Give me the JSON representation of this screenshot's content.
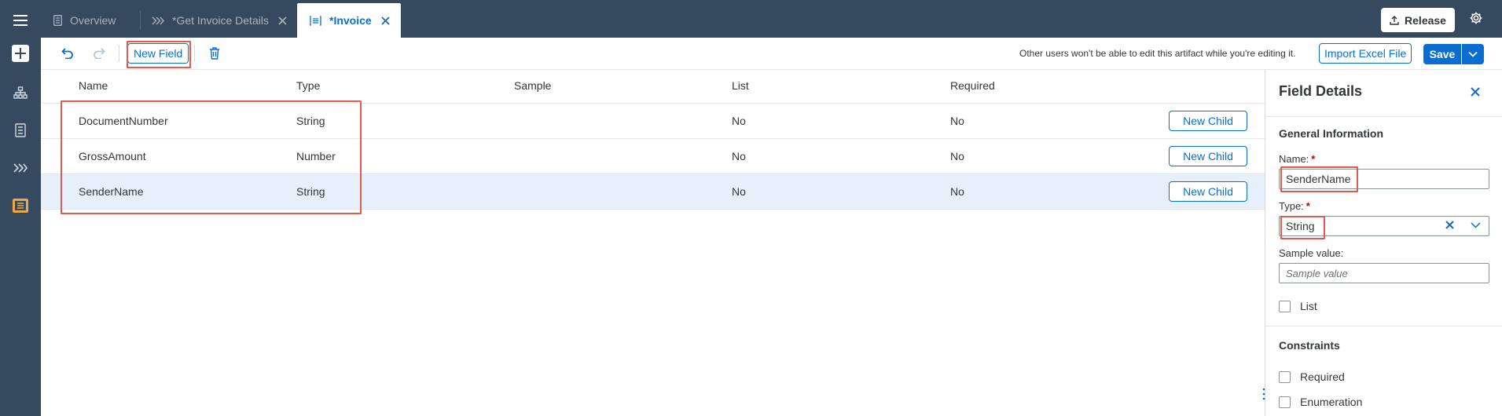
{
  "tabs": [
    {
      "label": "Overview",
      "icon": "document-icon",
      "active": false,
      "closable": false
    },
    {
      "label": "*Get Invoice Details",
      "icon": "chevrons-right-icon",
      "active": false,
      "closable": true
    },
    {
      "label": "*Invoice",
      "icon": "list-icon",
      "active": true,
      "closable": true
    }
  ],
  "header": {
    "release_label": "Release"
  },
  "toolbar": {
    "new_field_label": "New Field",
    "notice": "Other users won't be able to edit this artifact while you're editing it.",
    "import_label": "Import Excel File",
    "save_label": "Save"
  },
  "table": {
    "columns": [
      "Name",
      "Type",
      "Sample",
      "List",
      "Required"
    ],
    "rows": [
      {
        "name": "DocumentNumber",
        "type": "String",
        "sample": "",
        "list": "No",
        "required": "No",
        "action": "New Child"
      },
      {
        "name": "GrossAmount",
        "type": "Number",
        "sample": "",
        "list": "No",
        "required": "No",
        "action": "New Child"
      },
      {
        "name": "SenderName",
        "type": "String",
        "sample": "",
        "list": "No",
        "required": "No",
        "action": "New Child"
      }
    ],
    "selected_row": 2
  },
  "details": {
    "title": "Field Details",
    "general_title": "General Information",
    "name_label": "Name:",
    "name_value": "SenderName",
    "type_label": "Type:",
    "type_value": "String",
    "sample_label": "Sample value:",
    "sample_placeholder": "Sample value",
    "list_label": "List",
    "constraints_title": "Constraints",
    "required_label": "Required",
    "enumeration_label": "Enumeration"
  },
  "colors": {
    "shell": "#354a5f",
    "accent": "#0a6ed1",
    "highlight": "#e05a4f",
    "selected_row": "#e5f0fa"
  }
}
